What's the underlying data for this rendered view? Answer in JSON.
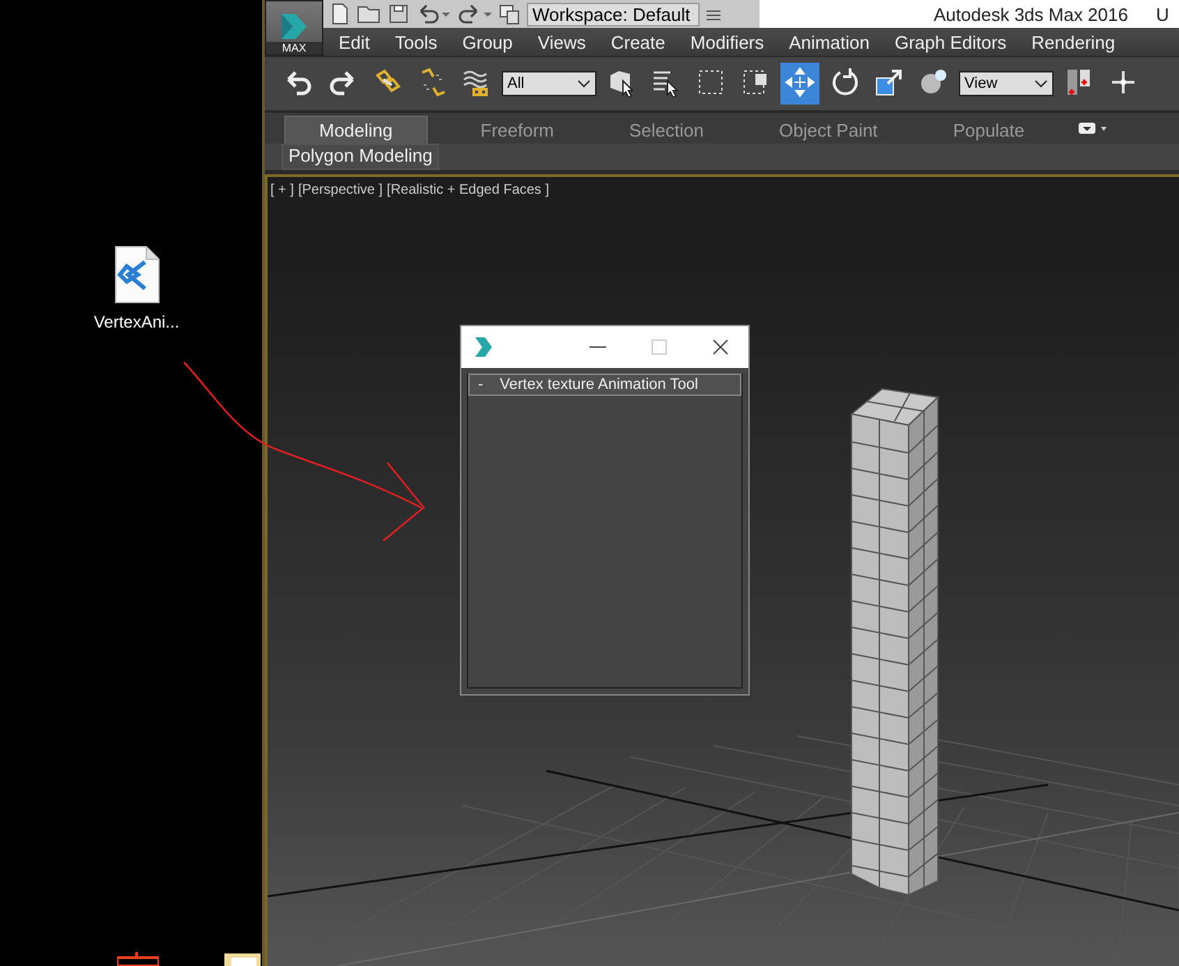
{
  "desktop": {
    "icons": [
      {
        "kind": "code-file",
        "label": "VertexAni..."
      },
      {
        "kind": "red-app"
      },
      {
        "kind": "folder"
      }
    ]
  },
  "app": {
    "title": "Autodesk 3ds Max 2016",
    "title_cut": "U",
    "logo_label": "MAX",
    "quick_access": [
      {
        "kind": "new"
      },
      {
        "kind": "open"
      },
      {
        "kind": "save"
      },
      {
        "kind": "undo"
      },
      {
        "kind": "redo"
      },
      {
        "kind": "project"
      }
    ],
    "workspace": "Workspace: Default",
    "menu": [
      "Edit",
      "Tools",
      "Group",
      "Views",
      "Create",
      "Modifiers",
      "Animation",
      "Graph Editors",
      "Rendering"
    ],
    "tools": [
      {
        "kind": "undo",
        "selected": false
      },
      {
        "kind": "redo",
        "selected": false
      },
      {
        "kind": "link",
        "selected": false
      },
      {
        "kind": "unlink",
        "selected": false
      },
      {
        "kind": "bind",
        "selected": false
      },
      {
        "kind": "dropdown",
        "value": "All"
      },
      {
        "kind": "select",
        "selected": false
      },
      {
        "kind": "select-name",
        "selected": false
      },
      {
        "kind": "rect-select",
        "selected": false
      },
      {
        "kind": "window-cross",
        "selected": false
      },
      {
        "kind": "move",
        "selected": true
      },
      {
        "kind": "rotate",
        "selected": false
      },
      {
        "kind": "scale",
        "selected": false
      },
      {
        "kind": "sphere",
        "selected": false
      },
      {
        "kind": "dropdown",
        "value": "View"
      },
      {
        "kind": "pivot",
        "selected": false
      },
      {
        "kind": "axis",
        "selected": false
      }
    ],
    "ribbon_tabs": [
      {
        "label": "Modeling",
        "selected": true
      },
      {
        "label": "Freeform",
        "selected": false
      },
      {
        "label": "Selection",
        "selected": false
      },
      {
        "label": "Object Paint",
        "selected": false
      },
      {
        "label": "Populate",
        "selected": false
      }
    ],
    "ribbon_panel": "Polygon Modeling",
    "viewport": {
      "labels": [
        "[ + ]",
        "[Perspective ]",
        "[Realistic + Edged Faces ]"
      ]
    },
    "dialog": {
      "rollout": {
        "toggle": "-",
        "title": "Vertex texture Animation Tool"
      }
    }
  }
}
